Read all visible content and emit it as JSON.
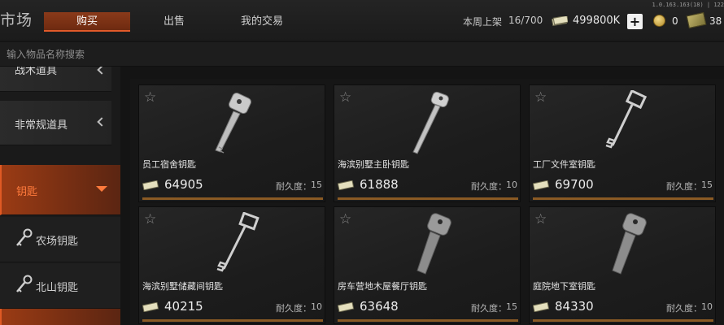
{
  "header": {
    "title": "市场",
    "tabs": [
      {
        "label": "购买",
        "active": true
      },
      {
        "label": "出售",
        "active": false
      },
      {
        "label": "我的交易",
        "active": false
      }
    ],
    "version": "1.0.163.163(18) | 122",
    "weekly_listing_label": "本周上架",
    "weekly_listing_count": "16/700",
    "balance": "499800K",
    "add_label": "+",
    "coins": "0",
    "bills": "38"
  },
  "search": {
    "placeholder": "输入物品名称搜索"
  },
  "sidebar": {
    "categories": [
      {
        "label": "战术道具",
        "expanded": false
      },
      {
        "label": "非常规道具",
        "expanded": false
      },
      {
        "label": "钥匙",
        "expanded": true
      }
    ],
    "subitems": [
      {
        "label": "农场钥匙",
        "icon": "key-icon"
      },
      {
        "label": "北山钥匙",
        "icon": "key-icon"
      }
    ]
  },
  "items": [
    {
      "name": "员工宿舍钥匙",
      "price": "64905",
      "durability_label": "耐久度：",
      "durability": "15",
      "key_style": "flat-key"
    },
    {
      "name": "海滨别墅主卧钥匙",
      "price": "61888",
      "durability_label": "耐久度：",
      "durability": "10",
      "key_style": "flat-key"
    },
    {
      "name": "工厂文件室钥匙",
      "price": "69700",
      "durability_label": "耐久度：",
      "durability": "15",
      "key_style": "skeleton-key"
    },
    {
      "name": "海滨别墅储藏间钥匙",
      "price": "40215",
      "durability_label": "耐久度：",
      "durability": "10",
      "key_style": "skeleton-key"
    },
    {
      "name": "房车营地木屋餐厅钥匙",
      "price": "63648",
      "durability_label": "耐久度：",
      "durability": "15",
      "key_style": "blank-key"
    },
    {
      "name": "庭院地下室钥匙",
      "price": "84330",
      "durability_label": "耐久度：",
      "durability": "10",
      "key_style": "blank-key"
    }
  ],
  "colors": {
    "accent": "#e05a24",
    "accent_dark": "#9a3b14",
    "durability_bar": "#8a5a24"
  }
}
